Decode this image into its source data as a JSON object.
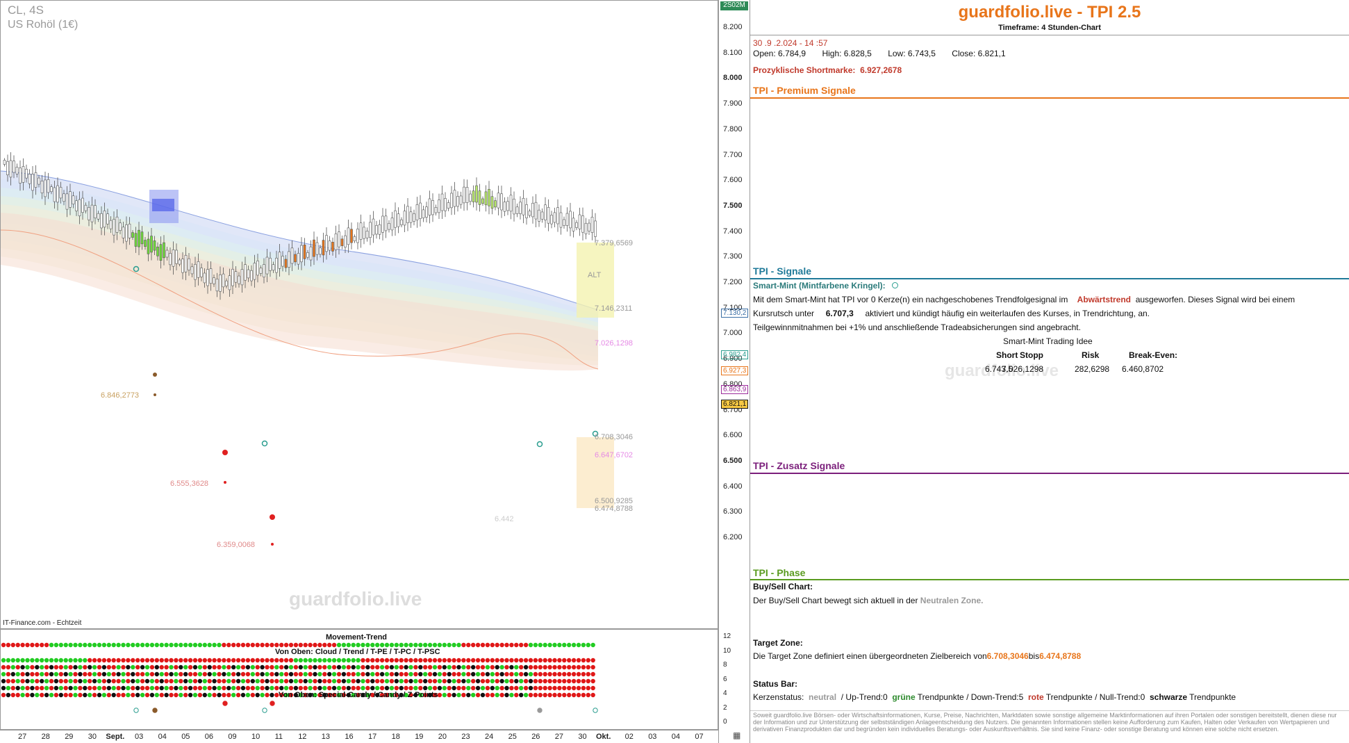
{
  "chart": {
    "symbol": "CL, 4S",
    "name": "US Rohöl (1€)",
    "watermark": "guardfolio.live",
    "source": "IT-Finance.com - Echtzeit",
    "volume_label": "2S02M",
    "y_ticks": [
      "8.200",
      "8.100",
      "8.000",
      "7.900",
      "7.800",
      "7.700",
      "7.600",
      "7.500",
      "7.400",
      "7.300",
      "7.200",
      "7.100",
      "7.000",
      "6.900",
      "6.800",
      "6.700",
      "6.600",
      "6.500",
      "6.400",
      "6.300",
      "6.200"
    ],
    "price_labels": [
      {
        "text": "7.130,2",
        "color": "#3a6ea5"
      },
      {
        "text": "6.982,4",
        "color": "#2a9d8f"
      },
      {
        "text": "6.927,3",
        "color": "#e8751a"
      },
      {
        "text": "6.863,9",
        "color": "#9b2a9b"
      },
      {
        "text": "6.821,1",
        "color": "#111"
      }
    ],
    "annotations": {
      "a1": "7.379,6569",
      "a2": "7.146,2311",
      "a3": "7.026,1298",
      "a4": "6.708,3046",
      "a5": "6.647,6702",
      "a6": "6.500,9285",
      "a7": "6.474,8788",
      "a8": "6.846,2773",
      "a9": "6.555,3628",
      "a10": "6.359,0068",
      "a11": "6.442"
    },
    "alt_label": "ALT",
    "indicator": {
      "title1": "Movement-Trend",
      "title2": "Von Oben: Cloud / Trend / T-PE / T-PC / T-PSC",
      "title3": "Von Oben: Special-Candy / Candy / Z-Points",
      "ticks": [
        "12",
        "10",
        "8",
        "6",
        "4",
        "2",
        "0"
      ]
    },
    "dates": [
      "27",
      "28",
      "29",
      "30",
      "Sept.",
      "03",
      "04",
      "05",
      "06",
      "09",
      "10",
      "11",
      "12",
      "13",
      "16",
      "17",
      "18",
      "19",
      "20",
      "23",
      "24",
      "25",
      "26",
      "27",
      "30",
      "Okt.",
      "02",
      "03",
      "04",
      "07"
    ]
  },
  "info": {
    "title": "guardfolio.live - TPI 2.5",
    "timeframe": "Timeframe: 4 Stunden-Chart",
    "date": "30 .9 .2.024 - 14 :57",
    "ohlc": {
      "open_l": "Open:",
      "open": "6.784,9",
      "high_l": "High:",
      "high": "6.828,5",
      "low_l": "Low:",
      "low": "6.743,5",
      "close_l": "Close:",
      "close": "6.821,1"
    },
    "short_mark_l": "Prozyklische Shortmarke:",
    "short_mark": "6.927,2678",
    "sec_premium": "TPI - Premium Signale",
    "sec_signale": "TPI - Signale",
    "smart_mint_h": "Smart-Mint (Mintfarbene Kringel):",
    "sm_line1_a": "Mit dem Smart-Mint hat TPI vor 0  Kerze(n) ein nachgeschobenes Trendfolgesignal im",
    "sm_line1_b": "Abwärtstrend",
    "sm_line1_c": "ausgeworfen. Dieses Signal wird bei einem",
    "sm_line2_a": "Kursrutsch unter",
    "sm_line2_b": "6.707,3",
    "sm_line2_c": "aktiviert und kündigt häufig ein weiterlaufen des Kurses, in Trendrichtung, an.",
    "sm_line3": "Teilgewinnmitnahmen bei +1% und anschließende Tradeabsicherungen sind angebracht.",
    "idea_title": "Smart-Mint Trading Idee",
    "idea_headers": [
      "Short",
      "Stopp",
      "Risk",
      "Break-Even:"
    ],
    "idea_values": [
      "6.743,5",
      "7.026,1298",
      "282,6298",
      "6.460,8702"
    ],
    "idea_watermark": "guardfolio.live",
    "sec_zusatz": "TPI - Zusatz Signale",
    "sec_phase": "TPI - Phase",
    "bs_h": "Buy/Sell Chart:",
    "bs_a": "Der Buy/Sell Chart bewegt sich aktuell in der",
    "bs_b": "Neutralen Zone.",
    "tz_h": "Target Zone:",
    "tz_a": "Die Target Zone definiert einen übergeordneten Zielbereich von",
    "tz_b": "6.708,3046",
    "tz_c": "bis",
    "tz_d": "6.474,8788",
    "sb_h": "Status Bar:",
    "sb_1": "Kerzenstatus:",
    "sb_2": "neutral",
    "sb_3": "/ Up-Trend:0",
    "sb_4": "grüne",
    "sb_5": "Trendpunkte  / Down-Trend:5",
    "sb_6": "rote",
    "sb_7": "Trendpunkte  / Null-Trend:0",
    "sb_8": "schwarze",
    "sb_9": "Trendpunkte",
    "disclaimer": "Soweit guardfolio.live Börsen- oder Wirtschaftsinformationen, Kurse, Preise, Nachrichten, Marktdaten sowie sonstige allgemeine Marktinformationen auf ihren Portalen oder sonstigen bereitstellt, dienen diese nur der Information und zur Unterstützung der selbstständigen Anlageentscheidung des Nutzers. Die genannten Informationen stellen keine Aufforderung zum Kaufen, Halten oder Verkaufen von Wertpapieren und derivativen Finanzprodukten dar und begründen kein individuelles Beratungs- oder Auskunftsverhältnis. Sie sind keine Finanz- oder sonstige Beratung und können eine solche nicht ersetzen."
  },
  "colors": {
    "orange": "#e8751a",
    "teal": "#1f7a99",
    "purple": "#7b1f7b",
    "green": "#5a9b1f",
    "red": "#c0392b"
  }
}
